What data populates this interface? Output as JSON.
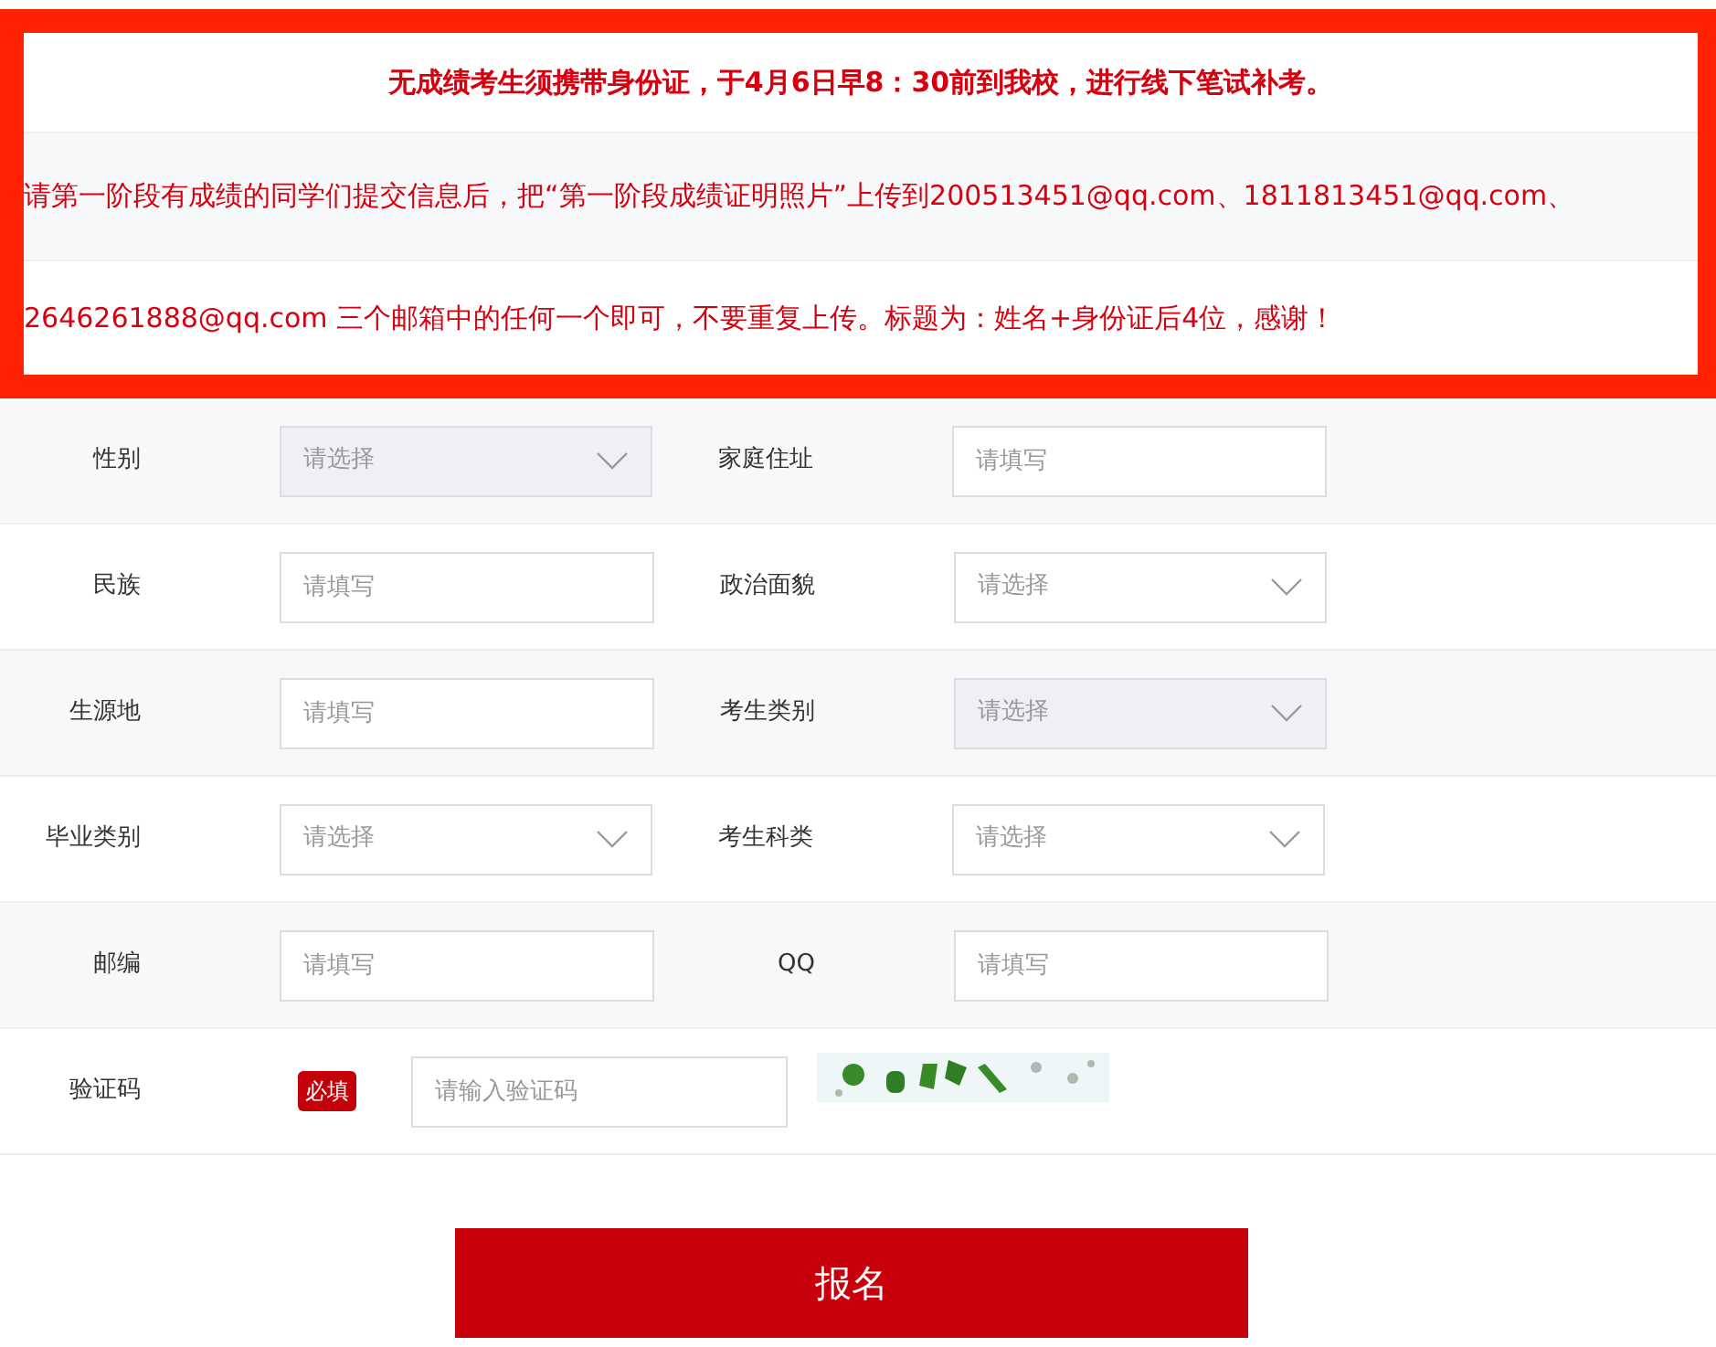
{
  "notice": {
    "lines": [
      {
        "kind": "heading",
        "text": "无成绩考生须携带身份证，于4月6日早8：30前到我校，进行线下笔试补考。"
      },
      {
        "kind": "text",
        "text": "请第一阶段有成绩的同学们提交信息后，把“第一阶段成绩证明照片”上传到200513451@qq.com、1811813451@qq.com、"
      },
      {
        "kind": "text",
        "text": "2646261888@qq.com 三个邮箱中的任何一个即可，不要重复上传。标题为：姓名+身份证后4位，感谢！"
      }
    ]
  },
  "form": {
    "rows": [
      {
        "fields": [
          {
            "label": "性别",
            "kind": "select",
            "placeholder": "请选择",
            "disabled": true
          },
          {
            "label": "家庭住址",
            "kind": "input",
            "placeholder": "请填写",
            "disabled": false
          }
        ]
      },
      {
        "fields": [
          {
            "label": "民族",
            "kind": "input",
            "placeholder": "请填写",
            "disabled": false
          },
          {
            "label": "政治面貌",
            "kind": "select",
            "placeholder": "请选择",
            "disabled": false
          }
        ]
      },
      {
        "fields": [
          {
            "label": "生源地",
            "kind": "input",
            "placeholder": "请填写",
            "disabled": false
          },
          {
            "label": "考生类别",
            "kind": "select",
            "placeholder": "请选择",
            "disabled": true
          }
        ]
      },
      {
        "fields": [
          {
            "label": "毕业类别",
            "kind": "select",
            "placeholder": "请选择",
            "disabled": false
          },
          {
            "label": "考生科类",
            "kind": "select",
            "placeholder": "请选择",
            "disabled": false
          }
        ]
      },
      {
        "fields": [
          {
            "label": "邮编",
            "kind": "input",
            "placeholder": "请填写",
            "disabled": false
          },
          {
            "label": "QQ",
            "kind": "input",
            "placeholder": "请填写",
            "disabled": false
          }
        ]
      }
    ],
    "captcha_row": {
      "label": "验证码",
      "badge": "必填",
      "placeholder": "请输入验证码"
    }
  },
  "submit_button": "报名"
}
